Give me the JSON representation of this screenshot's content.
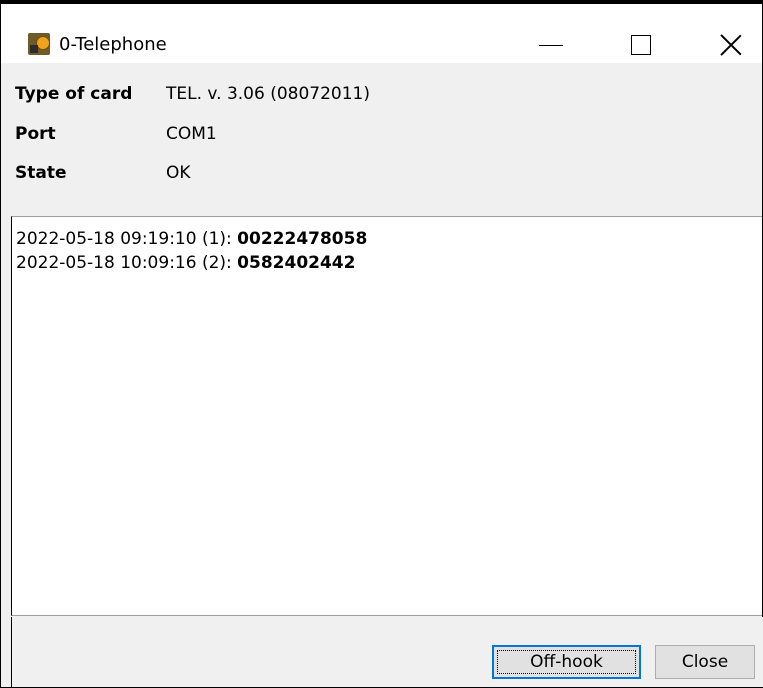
{
  "window": {
    "title": "0-Telephone",
    "icon": "telephone-card-icon"
  },
  "info": {
    "rows": [
      {
        "label": "Type of card",
        "value": "TEL. v. 3.06 (08072011)"
      },
      {
        "label": "Port",
        "value": "COM1"
      },
      {
        "label": "State",
        "value": "OK"
      }
    ]
  },
  "log": {
    "entries": [
      {
        "prefix": "2022-05-18 09:19:10 (1): ",
        "number": "00222478058"
      },
      {
        "prefix": "2022-05-18 10:09:16 (2): ",
        "number": "0582402442"
      }
    ]
  },
  "footer": {
    "offhook_label": "Off-hook",
    "close_label": "Close"
  }
}
